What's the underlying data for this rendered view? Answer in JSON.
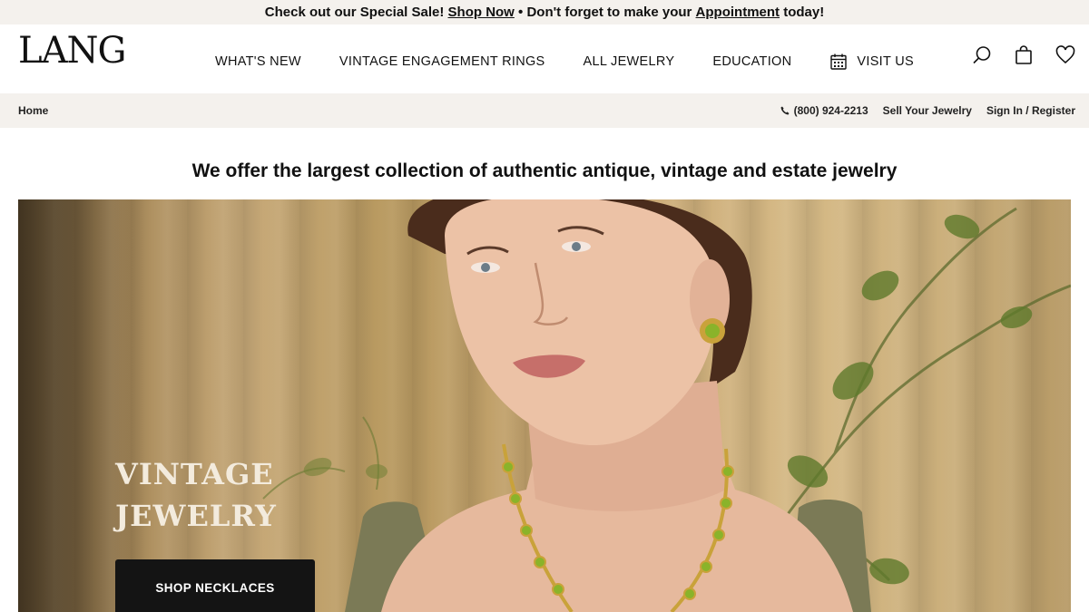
{
  "promo": {
    "part1": "Check out our Special Sale!",
    "link1": "Shop Now",
    "part2": "• Don't forget to make your",
    "link2": "Appointment",
    "part3": "today!"
  },
  "header": {
    "logo": "LANG",
    "nav": [
      "WHAT'S NEW",
      "VINTAGE ENGAGEMENT RINGS",
      "ALL JEWELRY",
      "EDUCATION",
      "VISIT US"
    ],
    "icons": [
      "search-icon",
      "shopping-bag-icon",
      "heart-icon",
      "calendar-icon"
    ]
  },
  "utility": {
    "breadcrumb": "Home",
    "phone": "(800) 924-2213",
    "sell": "Sell Your Jewelry",
    "signin": "Sign In",
    "separator": "/",
    "register": "Register"
  },
  "tagline": "We offer the largest collection of authentic antique, vintage and estate jewelry",
  "hero": {
    "title_line1": "VINTAGE",
    "title_line2": "JEWELRY",
    "button": "SHOP NECKLACES"
  },
  "colors": {
    "bar_bg": "#f4f1ed",
    "button_bg": "#141414",
    "hero_text": "#f3ebdd"
  }
}
